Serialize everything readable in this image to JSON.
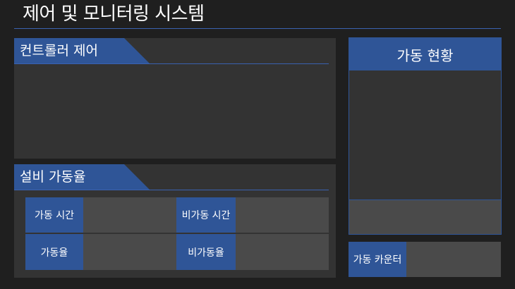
{
  "header": {
    "title": "제어 및 모니터링 시스템"
  },
  "controller_panel": {
    "title": "컨트롤러 제어"
  },
  "uptime_panel": {
    "title": "설비 가동율",
    "stats": [
      {
        "label": "가동 시간",
        "value": ""
      },
      {
        "label": "비가동 시간",
        "value": ""
      },
      {
        "label": "가동율",
        "value": ""
      },
      {
        "label": "비가동율",
        "value": ""
      }
    ]
  },
  "status_panel": {
    "title": "가동 현황",
    "footer_value": ""
  },
  "counter": {
    "label": "가동 카운터",
    "value": ""
  },
  "colors": {
    "accent": "#2f5597",
    "panel": "#333333",
    "cell": "#4a4a4a",
    "background": "#1f1f1f"
  }
}
